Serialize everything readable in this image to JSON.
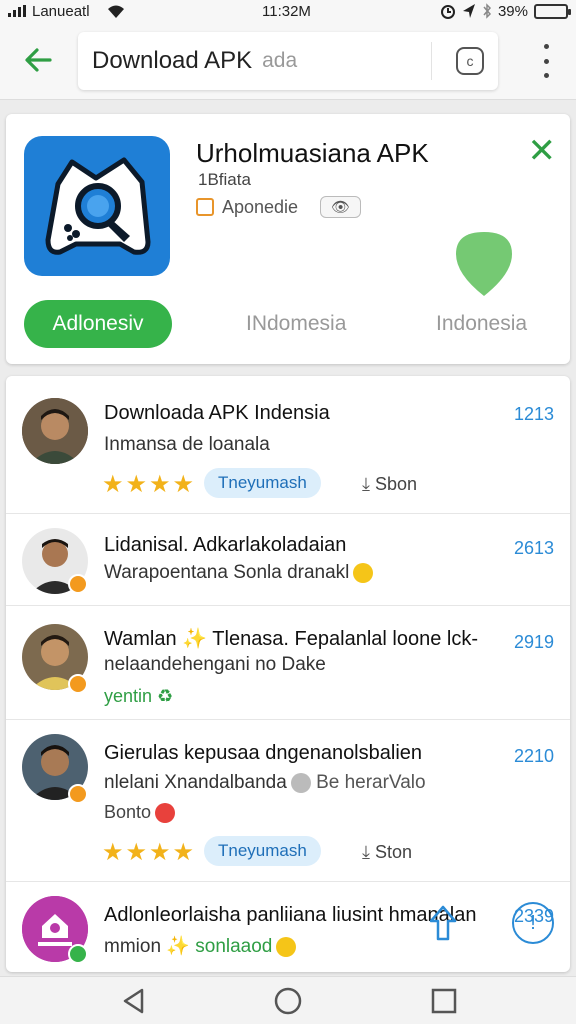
{
  "status_bar": {
    "carrier": "Lanueatl",
    "time": "11:32M",
    "battery": "39%",
    "battery_level": 0.39
  },
  "app_bar": {
    "search_query": "Download APK",
    "search_placeholder": "ada"
  },
  "app_card": {
    "title": "Urholmuasiana APK",
    "subtitle": "1Bfiata",
    "developer": "Aponedie",
    "install_label": "Adlonesiv",
    "tab_2_label": "INdomesia",
    "tab_3_label": "Indonesia"
  },
  "list_items": [
    {
      "title": "Downloada APK Indensia",
      "subtitle": "Inmansa de loanala",
      "number": "1213",
      "tag": "Tneyumash",
      "meta": "Sbon"
    },
    {
      "title": "Lidanisal. Adkarlakoladaian",
      "subtitle": "Warapoentana Sonla dranakl",
      "number": "2613"
    },
    {
      "title": "Wamlan",
      "title_rest": "Tlenasa. Fepalanlal loone lck-",
      "subtitle": "nelaandehengani no Dake",
      "extra": "yentin",
      "number": "2919"
    },
    {
      "title": "Gierulas kepusaa dngenanolsbalien",
      "subtitle": "nlelani Xnandalbanda",
      "subtitle_rest": "Be herarValo",
      "extra": "Bonto",
      "number": "2210",
      "tag": "Tneyumash",
      "meta": "Ston"
    },
    {
      "title": "Adlonleorlaisha panliiana liusint hmanalan",
      "subtitle": "mmion",
      "subtitle_rest": "sonlaaod",
      "number": "2339"
    }
  ]
}
